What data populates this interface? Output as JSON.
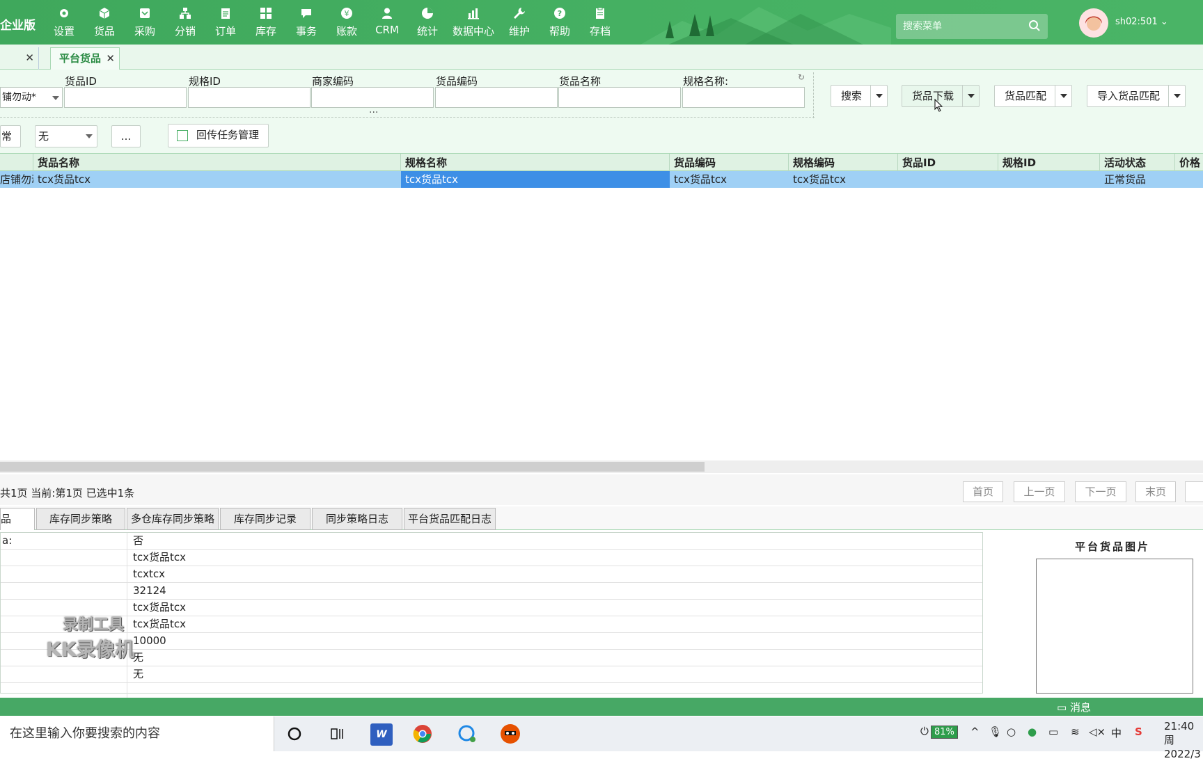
{
  "app": {
    "brand": "企业版"
  },
  "nav": [
    {
      "label": "设置",
      "icon": "gear-icon"
    },
    {
      "label": "货品",
      "icon": "box-icon"
    },
    {
      "label": "采购",
      "icon": "purchase-icon"
    },
    {
      "label": "分销",
      "icon": "distribution-icon"
    },
    {
      "label": "订单",
      "icon": "order-icon"
    },
    {
      "label": "库存",
      "icon": "inventory-icon"
    },
    {
      "label": "事务",
      "icon": "chat-icon"
    },
    {
      "label": "账款",
      "icon": "yen-icon"
    },
    {
      "label": "CRM",
      "icon": "person-icon"
    },
    {
      "label": "统计",
      "icon": "pie-chart-icon"
    },
    {
      "label": "数据中心",
      "icon": "bar-chart-icon"
    },
    {
      "label": "维护",
      "icon": "wrench-icon"
    },
    {
      "label": "帮助",
      "icon": "help-icon"
    },
    {
      "label": "存档",
      "icon": "archive-icon"
    }
  ],
  "search_menu": {
    "placeholder": "搜索菜单"
  },
  "user": {
    "name": "sh02:501"
  },
  "tabs": [
    {
      "label": ""
    },
    {
      "label": "平台货品"
    }
  ],
  "filters": {
    "shop_value": "铺勿动*",
    "labels": [
      "货品ID",
      "规格ID",
      "商家编码",
      "货品编码",
      "货品名称",
      "规格名称:"
    ],
    "more": "...",
    "row2_left": "常",
    "row2_select": "无",
    "row2_more": "...",
    "callback_btn": "回传任务管理",
    "search_btn": "搜索",
    "download_btn": "货品下载",
    "match_btn": "货品匹配",
    "import_btn": "导入货品匹配"
  },
  "grid": {
    "headers": [
      "",
      "货品名称",
      "规格名称",
      "货品编码",
      "规格编码",
      "货品ID",
      "规格ID",
      "活动状态",
      "价格"
    ],
    "rows": [
      [
        "店铺勿动",
        "tcx货品tcx",
        "tcx货品tcx",
        "tcx货品tcx",
        "tcx货品tcx",
        "",
        "",
        "正常货品",
        ""
      ]
    ]
  },
  "pager": {
    "info": "共1页  当前:第1页  已选中1条",
    "first": "首页",
    "prev": "上一页",
    "next": "下一页",
    "last": "末页"
  },
  "detail_tabs": [
    "品",
    "库存同步策略",
    "多仓库存同步策略",
    "库存同步记录",
    "同步策略日志",
    "平台货品匹配日志"
  ],
  "detail_rows": [
    {
      "k": "a:",
      "v": "否"
    },
    {
      "k": "",
      "v": "tcx货品tcx"
    },
    {
      "k": "",
      "v": "tcxtcx"
    },
    {
      "k": "",
      "v": "32124"
    },
    {
      "k": "",
      "v": "tcx货品tcx"
    },
    {
      "k": "",
      "v": "tcx货品tcx"
    },
    {
      "k": "",
      "v": "10000"
    },
    {
      "k": "",
      "v": "无"
    },
    {
      "k": "",
      "v": "无"
    },
    {
      "k": "",
      "v": ""
    }
  ],
  "image_panel": {
    "title": "平台货品图片"
  },
  "watermark": {
    "line1": "录制工具",
    "line2": "KK录像机"
  },
  "status": {
    "message": "消息"
  },
  "taskbar": {
    "search": "在这里输入你要搜索的内容",
    "battery": "81%",
    "ime": "中",
    "time": "21:40 周",
    "date": "2022/3"
  }
}
